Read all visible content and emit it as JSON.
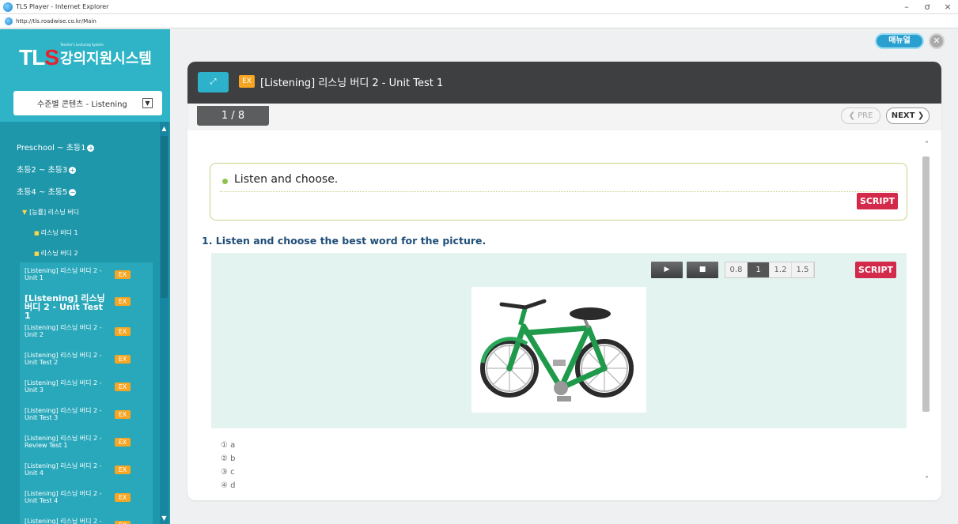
{
  "window": {
    "title": "TLS Player - Internet Explorer",
    "url": "http://tls.roadwise.co.kr/Main",
    "min": "–",
    "max": "ơ",
    "close": "×"
  },
  "logo": {
    "brand_t": "T",
    "brand_l": "L",
    "brand_s": "S",
    "tagline": "Teacher's Lecturing System",
    "system_name": "강의지원시스템"
  },
  "sidebar": {
    "level_select": "수준별 콘텐츠 - Listening",
    "tree": {
      "preschool": "Preschool ~ 초등1",
      "grade2": "초등2 ~ 초등3",
      "grade4": "초등4 ~ 초등5",
      "folder": "[능률] 리스닝 버디",
      "book1": "리스닝 버디 1",
      "book2": "리스닝 버디 2"
    },
    "units": [
      {
        "label": "[Listening] 리스닝 버디 2 - Unit 1",
        "ex": "EX"
      },
      {
        "label": "[Listening] 리스닝 버디 2 - Unit Test 1",
        "ex": "EX"
      },
      {
        "label": "[Listening] 리스닝 버디 2 - Unit 2",
        "ex": "EX"
      },
      {
        "label": "[Listening] 리스닝 버디 2 - Unit Test 2",
        "ex": "EX"
      },
      {
        "label": "[Listening] 리스닝 버디 2 - Unit 3",
        "ex": "EX"
      },
      {
        "label": "[Listening] 리스닝 버디 2 - Unit Test 3",
        "ex": "EX"
      },
      {
        "label": "[Listening] 리스닝 버디 2 - Review Test 1",
        "ex": "EX"
      },
      {
        "label": "[Listening] 리스닝 버디 2 - Unit 4",
        "ex": "EX"
      },
      {
        "label": "[Listening] 리스닝 버디 2 - Unit Test 4",
        "ex": "EX"
      },
      {
        "label": "[Listening] 리스닝 버디 2 -",
        "ex": "EX"
      }
    ]
  },
  "header": {
    "manual": "매뉴얼",
    "close": "✕"
  },
  "panel": {
    "ex_badge": "EX",
    "title": "[Listening] 리스닝 버디 2 - Unit Test 1",
    "page": "1 / 8",
    "pre": "❮ PRE",
    "next": "NEXT ❯"
  },
  "content": {
    "direction": "Listen and choose.",
    "script": "SCRIPT",
    "question": "1. Listen and choose the best word for the picture.",
    "speeds": [
      "0.8",
      "1",
      "1.2",
      "1.5"
    ],
    "selected_speed": "1",
    "choices": [
      "① a",
      "② b",
      "③ c",
      "④ d"
    ]
  },
  "colors": {
    "sidebar": "#2eb4c6",
    "header_dark": "#3d3f41",
    "script_red": "#d32a4c",
    "ex_orange": "#f6a623"
  }
}
